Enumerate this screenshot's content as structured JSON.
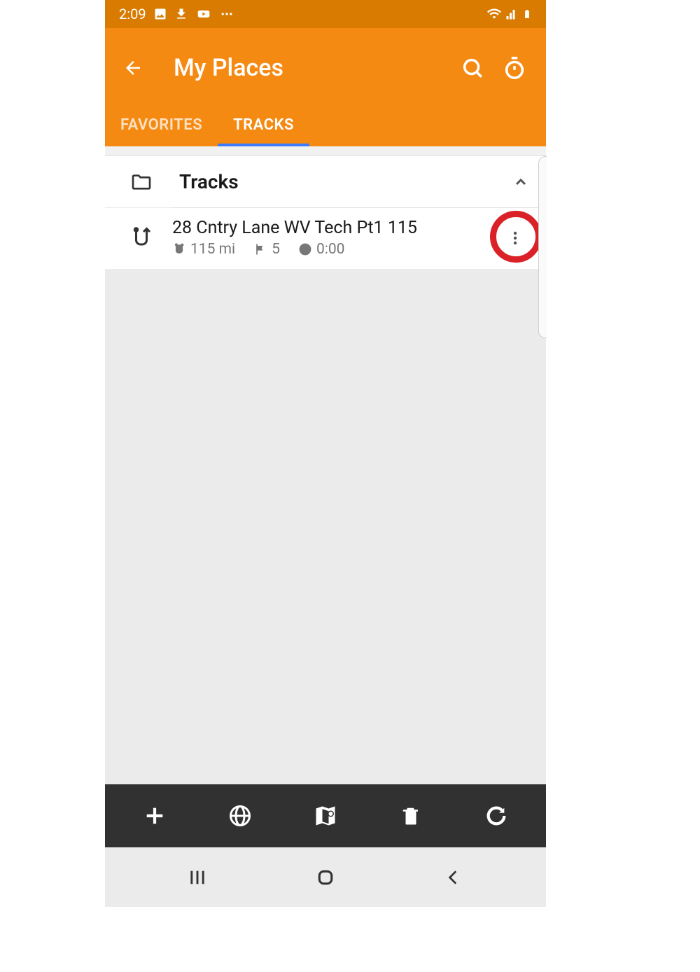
{
  "status_bar": {
    "time": "2:09"
  },
  "header": {
    "title": "My Places"
  },
  "tabs": {
    "favorites_label": "FAVORITES",
    "tracks_label": "TRACKS"
  },
  "folder": {
    "name": "Tracks"
  },
  "track": {
    "title": "28 Cntry Lane WV Tech Pt1 115",
    "distance": "115 mi",
    "waypoints": "5",
    "duration": "0:00"
  }
}
